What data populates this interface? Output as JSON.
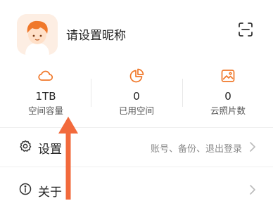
{
  "profile": {
    "nickname": "请设置昵称",
    "avatar_icon": "cartoon-avatar",
    "scan_icon": "scan-icon"
  },
  "stats": [
    {
      "icon": "cloud-icon",
      "value": "1TB",
      "label": "空间容量"
    },
    {
      "icon": "pie-chart-icon",
      "value": "0",
      "label": "已用空间"
    },
    {
      "icon": "image-icon",
      "value": "0",
      "label": "云照片数"
    }
  ],
  "menu": {
    "settings": {
      "icon": "gear-icon",
      "title": "设置",
      "desc": "账号、备份、退出登录"
    },
    "about": {
      "icon": "info-icon",
      "title": "关于"
    }
  },
  "colors": {
    "accent": "#f0782a",
    "arrow": "#f26a3c",
    "text": "#222222",
    "secondary": "#888888"
  }
}
